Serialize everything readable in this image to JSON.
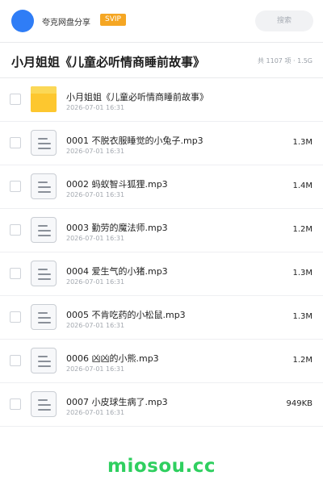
{
  "header": {
    "owner_name": "夸克网盘分享",
    "badge": "SVIP",
    "search_placeholder": "搜索"
  },
  "folder": {
    "title": "小月姐姐《儿童必听情商睡前故事》",
    "stats": "共 1107 项 · 1.5G"
  },
  "files": [
    {
      "name": "小月姐姐《儿童必听情商睡前故事》",
      "date": "2026-07-01 16:31",
      "size": "",
      "icon": "folder-icon"
    },
    {
      "name": "0001 不脱衣服睡觉的小兔子.mp3",
      "date": "2026-07-01 16:31",
      "size": "1.3M",
      "icon": "audio-file-icon"
    },
    {
      "name": "0002 蚂蚁智斗狐狸.mp3",
      "date": "2026-07-01 16:31",
      "size": "1.4M",
      "icon": "audio-file-icon"
    },
    {
      "name": "0003 勤劳的魔法师.mp3",
      "date": "2026-07-01 16:31",
      "size": "1.2M",
      "icon": "audio-file-icon"
    },
    {
      "name": "0004 爱生气的小猪.mp3",
      "date": "2026-07-01 16:31",
      "size": "1.3M",
      "icon": "audio-file-icon"
    },
    {
      "name": "0005 不肯吃药的小松鼠.mp3",
      "date": "2026-07-01 16:31",
      "size": "1.3M",
      "icon": "audio-file-icon"
    },
    {
      "name": "0006 凶凶的小熊.mp3",
      "date": "2026-07-01 16:31",
      "size": "1.2M",
      "icon": "audio-file-icon"
    },
    {
      "name": "0007 小皮球生病了.mp3",
      "date": "2026-07-01 16:31",
      "size": "949KB",
      "icon": "audio-file-icon"
    }
  ],
  "watermark": "miosou.cc",
  "colors": {
    "accent": "#2f7df6",
    "badge": "#f5a623",
    "folder": "#fdc72f",
    "watermark": "#2fcf5f"
  }
}
